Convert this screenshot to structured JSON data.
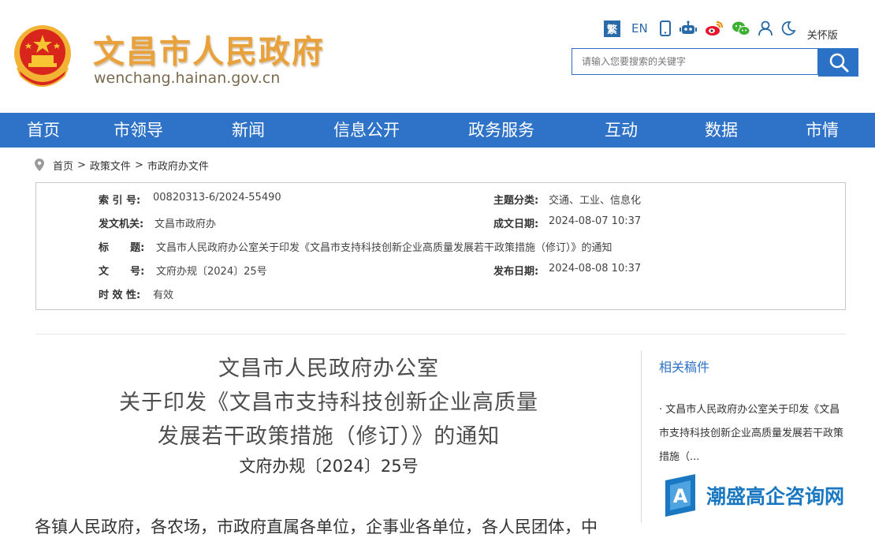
{
  "header": {
    "site_title": "文昌市人民政府",
    "site_url": "wenchang.hainan.gov.cn",
    "tools": {
      "traditional": "繁",
      "english": "EN",
      "care_mode": "关怀版"
    },
    "search": {
      "placeholder": "请输入您要搜索的关键字"
    }
  },
  "nav": {
    "items": [
      "首页",
      "市领导",
      "新闻",
      "信息公开",
      "政务服务",
      "互动",
      "数据",
      "市情"
    ]
  },
  "breadcrumb": {
    "items": [
      "首页",
      "政策文件",
      "市政府办文件"
    ],
    "separator": ">"
  },
  "meta": {
    "index_label": "索 引 号:",
    "index_value": "00820313-6/2024-55490",
    "topic_label": "主题分类:",
    "topic_value": "交通、工业、信息化",
    "issuer_label": "发文机关:",
    "issuer_value": "文昌市政府办",
    "created_label": "成文日期:",
    "created_value": "2024-08-07 10:37",
    "title_label": "标      题:",
    "title_value": "文昌市人民政府办公室关于印发《文昌市支持科技创新企业高质量发展若干政策措施（修订）》的通知",
    "docno_label": "文      号:",
    "docno_value": "文府办规〔2024〕25号",
    "published_label": "发布日期:",
    "published_value": "2024-08-08 10:37",
    "validity_label": "时 效 性:",
    "validity_value": "有效"
  },
  "article": {
    "title_lines": [
      "文昌市人民政府办公室",
      "关于印发《文昌市支持科技创新企业高质量",
      "发展若干政策措施（修订）》的通知"
    ],
    "doc_number": "文府办规〔2024〕25号",
    "body_first_line": "各镇人民政府，各农场，市政府直属各单位，企事业各单位，各人民团体，中"
  },
  "sidebar": {
    "title": "相关稿件",
    "link": "· 文昌市人民政府办公室关于印发《文昌市支持科技创新企业高质量发展若干政策措施（..."
  },
  "watermark": {
    "text": "潮盛高企咨询网"
  },
  "colors": {
    "primary_blue": "#2e73c8",
    "title_gold": "#e9a23b",
    "emblem_red": "#d8261c"
  }
}
